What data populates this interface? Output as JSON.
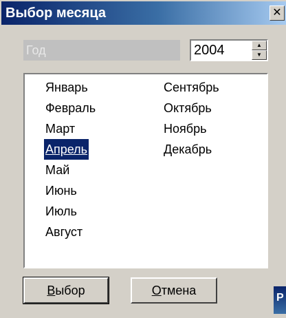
{
  "window": {
    "title": "Выбор месяца",
    "close_glyph": "✕"
  },
  "year": {
    "label": "Год",
    "value": "2004",
    "up_glyph": "▲",
    "down_glyph": "▼"
  },
  "months": {
    "col1": [
      "Январь",
      "Февраль",
      "Март",
      "Апрель",
      "Май",
      "Июнь",
      "Июль",
      "Август"
    ],
    "col2": [
      "Сентябрь",
      "Октябрь",
      "Ноябрь",
      "Декабрь"
    ],
    "selected": "Апрель"
  },
  "buttons": {
    "select": {
      "hotkey": "В",
      "rest": "ыбор"
    },
    "cancel": {
      "hotkey": "О",
      "rest": "тмена"
    }
  },
  "background": {
    "fragment": "Р"
  },
  "colors": {
    "titlebar_start": "#0a246a",
    "titlebar_end": "#a6caf0",
    "selection": "#0a246a",
    "face": "#d4d0c8"
  }
}
